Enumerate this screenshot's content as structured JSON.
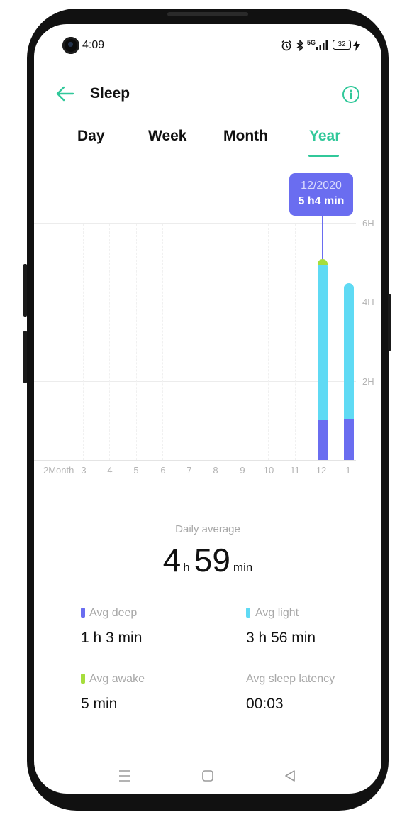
{
  "status": {
    "time": "4:09",
    "network": "5G",
    "battery": "32"
  },
  "header": {
    "title": "Sleep"
  },
  "tabs": [
    "Day",
    "Week",
    "Month",
    "Year"
  ],
  "active_tab": "Year",
  "tooltip": {
    "date": "12/2020",
    "value": "5 h4 min"
  },
  "chart_data": {
    "type": "bar",
    "categories": [
      "2Month",
      "3",
      "4",
      "5",
      "6",
      "7",
      "8",
      "9",
      "10",
      "11",
      "12",
      "1"
    ],
    "series": [
      {
        "name": "Avg deep",
        "values": [
          0,
          0,
          0,
          0,
          0,
          0,
          0,
          0,
          0,
          0,
          1.03,
          1.05
        ]
      },
      {
        "name": "Avg light",
        "values": [
          0,
          0,
          0,
          0,
          0,
          0,
          0,
          0,
          0,
          0,
          3.98,
          3.42
        ]
      },
      {
        "name": "Avg awake",
        "values": [
          0,
          0,
          0,
          0,
          0,
          0,
          0,
          0,
          0,
          0,
          0.08,
          0
        ]
      }
    ],
    "y_ticks": [
      "2H",
      "4H",
      "6H"
    ],
    "ylim": [
      0,
      6
    ],
    "colors": {
      "deep": "#6a6df0",
      "light": "#5fdaf4",
      "awake": "#a6dd3c"
    },
    "selected_category": "12"
  },
  "summary": {
    "daily_average_label": "Daily average",
    "hours": "4",
    "hours_unit": "h",
    "minutes": "59",
    "minutes_unit": "min"
  },
  "stats": {
    "avg_deep": {
      "label": "Avg deep",
      "value": "1 h 3 min"
    },
    "avg_light": {
      "label": "Avg light",
      "value": "3 h 56 min"
    },
    "avg_awake": {
      "label": "Avg awake",
      "value": "5 min"
    },
    "avg_latency": {
      "label": "Avg sleep latency",
      "value": "00:03"
    }
  },
  "accent_color": "#31c89a"
}
